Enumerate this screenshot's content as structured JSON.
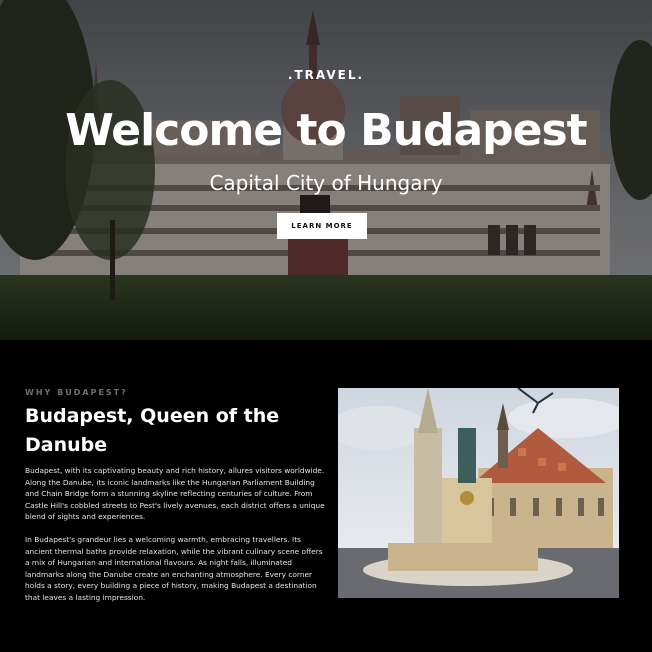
{
  "hero": {
    "kicker": ".TRAVEL.",
    "title": "Welcome to Budapest",
    "subtitle": "Capital City of Hungary",
    "button_label": "LEARN MORE"
  },
  "about": {
    "eyebrow": "WHY BUDAPEST?",
    "title": "Budapest, Queen of the Danube",
    "paragraphs": [
      "Budapest, with its captivating beauty and rich history, allures visitors worldwide. Along the Danube, its iconic landmarks like the Hungarian Parliament Building and Chain Bridge form a stunning skyline reflecting centuries of culture. From Castle Hill's cobbled streets to Pest's lively avenues, each district offers a unique blend of sights and experiences.",
      "In Budapest's grandeur lies a welcoming warmth, embracing travellers. Its ancient thermal baths provide relaxation, while the vibrant culinary scene offers a mix of Hungarian and international flavours. As night falls, illuminated landmarks along the Danube create an enchanting atmosphere. Every corner holds a story, every building a piece of history, making Budapest a destination that leaves a lasting impression."
    ]
  },
  "colors": {
    "page_background": "#000000",
    "button_background": "#ffffff",
    "eyebrow": "#6f6f6f"
  }
}
